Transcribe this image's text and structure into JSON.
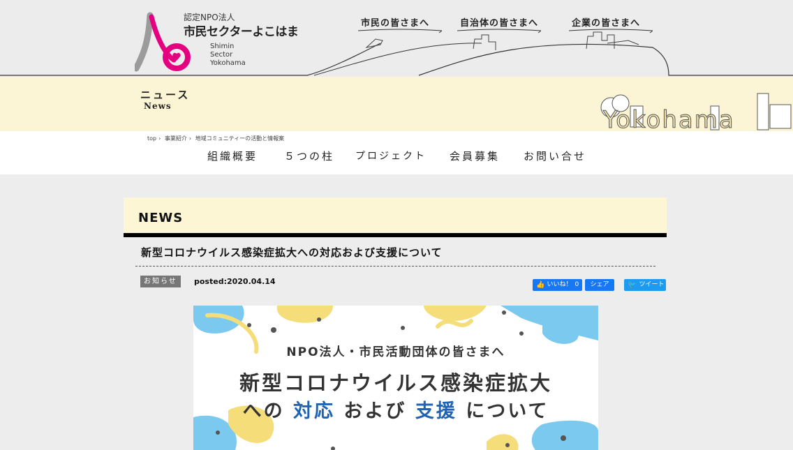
{
  "logo": {
    "npo_label": "認定NPO法人",
    "org_name": "市民セクターよこはま",
    "english_name": [
      "Shimin",
      "Sector",
      "Yokohama"
    ]
  },
  "top_nav": [
    {
      "label": "市民の皆さまへ"
    },
    {
      "label": "自治体の皆さまへ"
    },
    {
      "label": "企業の皆さまへ"
    }
  ],
  "band": {
    "title": "ニュース",
    "subtitle": "News",
    "city_lettering": "Yokohama"
  },
  "breadcrumb": [
    "top",
    "事業紹介",
    "地域コミュニティーの活動と情報案"
  ],
  "main_nav": [
    {
      "label": "組織概要"
    },
    {
      "label": "５つの柱"
    },
    {
      "label": "プロジェクト"
    },
    {
      "label": "会員募集"
    },
    {
      "label": "お問い合せ"
    }
  ],
  "content": {
    "section_heading": "NEWS",
    "article_title": "新型コロナウイルス感染症拡大への対応および支援について",
    "category": "お知らせ",
    "posted": "posted:2020.04.14"
  },
  "social": {
    "like_label": "いいね！",
    "like_count": "0",
    "share_label": "シェア",
    "tweet_label": "ツイート"
  },
  "banner": {
    "line1": "NPO法人・市民活動団体の皆さまへ",
    "line2": "新型コロナウイルス感染症拡大",
    "line3_parts": [
      "への ",
      "対応",
      " および ",
      "支援",
      " について"
    ]
  },
  "colors": {
    "brand_magenta": "#e4007f",
    "cream": "#fcf5d5",
    "facebook": "#1877f2",
    "twitter": "#1d9bf0",
    "banner_highlight": "#1e63b5"
  }
}
